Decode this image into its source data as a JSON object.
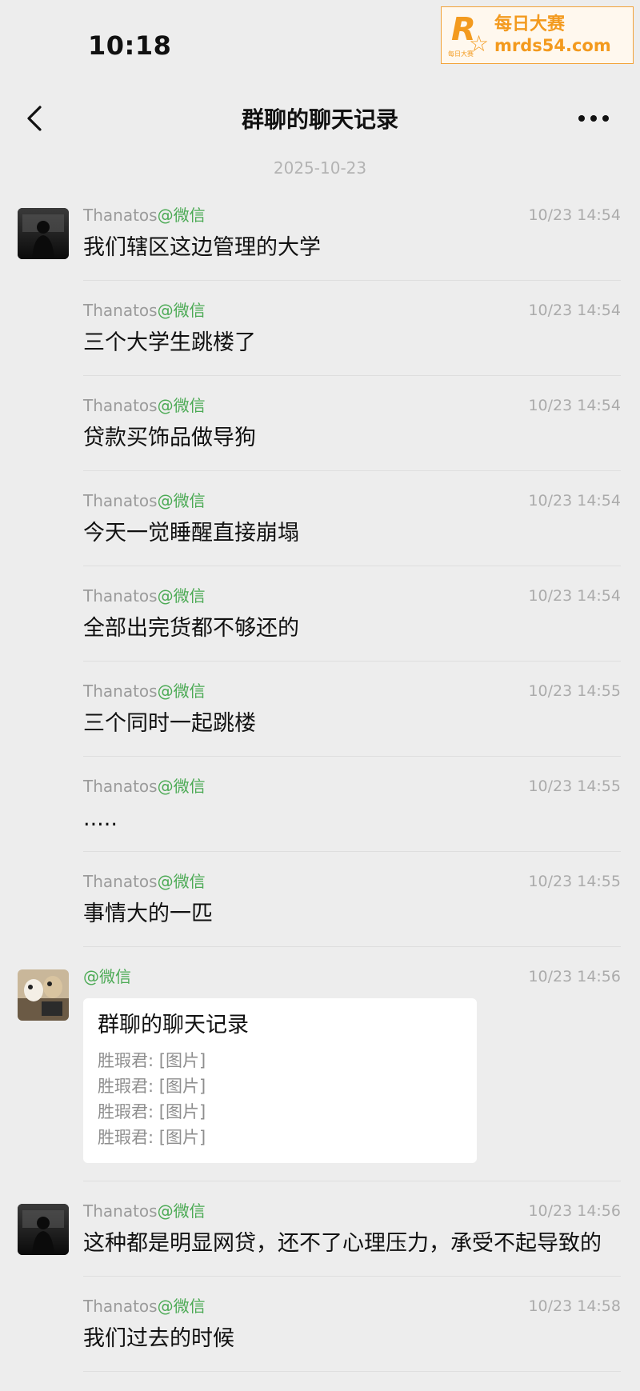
{
  "status_bar": {
    "time": "10:18"
  },
  "watermark": {
    "logo_letter": "R",
    "logo_small": "每日大赛",
    "title": "每日大赛",
    "url": "mrds54.com"
  },
  "header": {
    "title": "群聊的聊天记录",
    "back_icon": "chevron-left-icon",
    "more_icon": "more-dots-icon"
  },
  "date_separator": "2025-10-23",
  "messages": [
    {
      "sender_name": "Thanatos",
      "sender_suffix": "@微信",
      "time": "10/23 14:54",
      "text": "我们辖区这边管理的大学",
      "show_avatar": true
    },
    {
      "sender_name": "Thanatos",
      "sender_suffix": "@微信",
      "time": "10/23 14:54",
      "text": "三个大学生跳楼了"
    },
    {
      "sender_name": "Thanatos",
      "sender_suffix": "@微信",
      "time": "10/23 14:54",
      "text": "贷款买饰品做导狗"
    },
    {
      "sender_name": "Thanatos",
      "sender_suffix": "@微信",
      "time": "10/23 14:54",
      "text": "今天一觉睡醒直接崩塌"
    },
    {
      "sender_name": "Thanatos",
      "sender_suffix": "@微信",
      "time": "10/23 14:54",
      "text": "全部出完货都不够还的"
    },
    {
      "sender_name": "Thanatos",
      "sender_suffix": "@微信",
      "time": "10/23 14:55",
      "text": "三个同时一起跳楼"
    },
    {
      "sender_name": "Thanatos",
      "sender_suffix": "@微信",
      "time": "10/23 14:55",
      "text": "....."
    },
    {
      "sender_name": "Thanatos",
      "sender_suffix": "@微信",
      "time": "10/23 14:55",
      "text": "事情大的一匹"
    },
    {
      "sender_name": "",
      "sender_suffix": "@微信",
      "time": "10/23 14:56",
      "show_avatar": true,
      "card": {
        "title": "群聊的聊天记录",
        "lines": [
          "胜瑕君: [图片]",
          "胜瑕君: [图片]",
          "胜瑕君: [图片]",
          "胜瑕君: [图片]"
        ]
      }
    },
    {
      "sender_name": "Thanatos",
      "sender_suffix": "@微信",
      "time": "10/23 14:56",
      "text": "这种都是明显网贷，还不了心理压力，承受不起导致的",
      "show_avatar": true
    },
    {
      "sender_name": "Thanatos",
      "sender_suffix": "@微信",
      "time": "10/23 14:58",
      "text": "我们过去的时候"
    }
  ]
}
